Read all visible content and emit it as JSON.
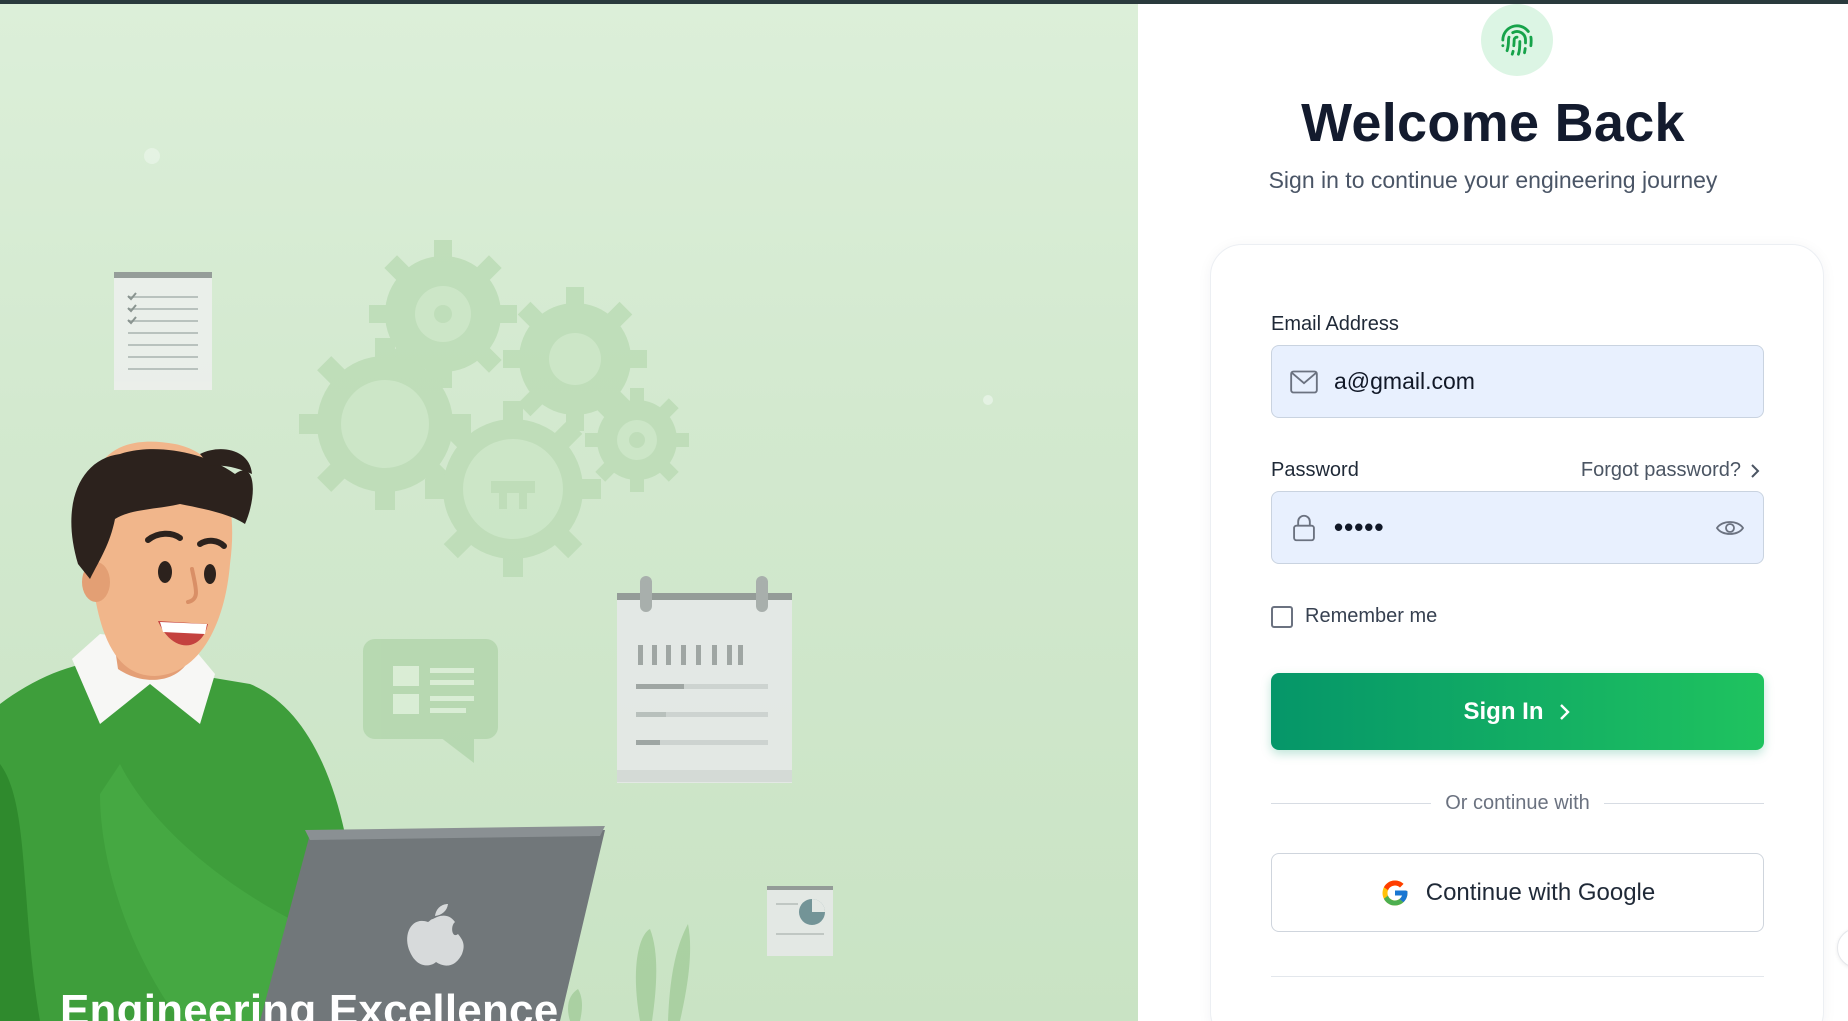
{
  "hero": {
    "caption": "Engineering Excellence"
  },
  "header": {
    "logo_icon": "fingerprint-icon",
    "title": "Welcome Back",
    "subtitle": "Sign in to continue your engineering journey"
  },
  "form": {
    "email": {
      "label": "Email Address",
      "value": "a@gmail.com",
      "icon": "mail-icon"
    },
    "password": {
      "label": "Password",
      "value": "•••••",
      "icon": "lock-icon",
      "toggle_icon": "eye-icon",
      "forgot_label": "Forgot password?"
    },
    "remember_label": "Remember me",
    "remember_checked": false,
    "signin_label": "Sign In",
    "divider_text": "Or continue with",
    "google_label": "Continue with Google"
  },
  "colors": {
    "accent": "#059669",
    "accent_light": "#1fc35f",
    "input_bg": "#e8f0fe",
    "title": "#131b2e"
  }
}
